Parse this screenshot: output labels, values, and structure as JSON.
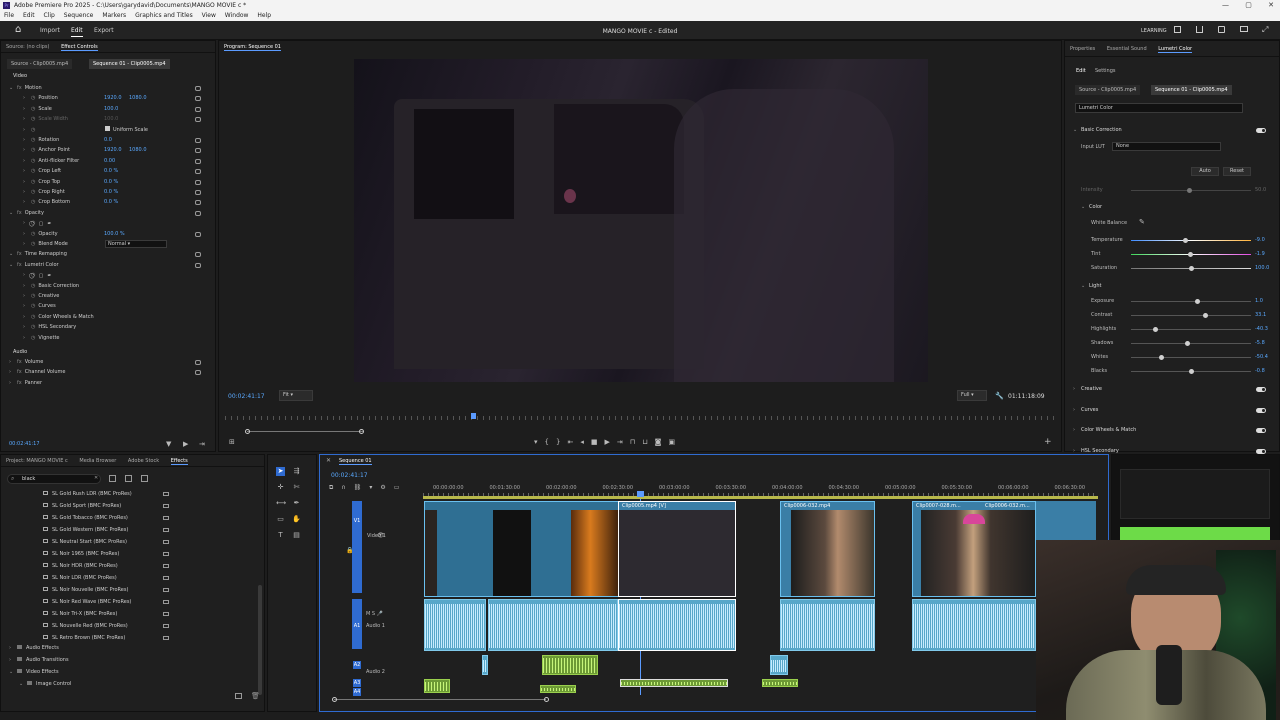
{
  "titlebar": {
    "title": "Adobe Premiere Pro 2025 - C:\\Users\\garydavid\\Documents\\MANGO MOVIE c *",
    "controls": [
      "—",
      "▢",
      "✕"
    ]
  },
  "menu": [
    "File",
    "Edit",
    "Clip",
    "Sequence",
    "Markers",
    "Graphics and Titles",
    "View",
    "Window",
    "Help"
  ],
  "appbar": {
    "home": "⌂",
    "workspaces": [
      "Import",
      "Edit",
      "Export"
    ],
    "active": "Edit",
    "doc_title": "MANGO MOVIE c - Edited",
    "learning": "LEARNING"
  },
  "effect_controls": {
    "tabs": [
      "Source: (no clips)",
      "Effect Controls"
    ],
    "source_tab": "Source - Clip0005.mp4",
    "seq_tab": "Sequence 01 - Clip0005.mp4",
    "video_label": "Video",
    "audio_label": "Audio",
    "rows": [
      {
        "name": "Motion",
        "fx": true,
        "indent": 0
      },
      {
        "name": "Position",
        "v1": "1920.0",
        "v2": "1080.0",
        "indent": 1
      },
      {
        "name": "Scale",
        "v1": "100.0",
        "indent": 1
      },
      {
        "name": "Scale Width",
        "v1": "100.0",
        "indent": 1,
        "dim": true
      },
      {
        "name": "",
        "check": "Uniform Scale",
        "indent": 1
      },
      {
        "name": "Rotation",
        "v1": "0.0",
        "indent": 1
      },
      {
        "name": "Anchor Point",
        "v1": "1920.0",
        "v2": "1080.0",
        "indent": 1
      },
      {
        "name": "Anti-flicker Filter",
        "v1": "0.00",
        "indent": 1
      },
      {
        "name": "Crop Left",
        "v1": "0.0 %",
        "indent": 1
      },
      {
        "name": "Crop Top",
        "v1": "0.0 %",
        "indent": 1
      },
      {
        "name": "Crop Right",
        "v1": "0.0 %",
        "indent": 1
      },
      {
        "name": "Crop Bottom",
        "v1": "0.0 %",
        "indent": 1
      },
      {
        "name": "Opacity",
        "fx": true,
        "indent": 0
      },
      {
        "name": "",
        "icons": true,
        "indent": 1
      },
      {
        "name": "Opacity",
        "v1": "100.0 %",
        "indent": 1
      },
      {
        "name": "Blend Mode",
        "sel": "Normal",
        "indent": 1
      },
      {
        "name": "Time Remapping",
        "fx": true,
        "indent": 0
      },
      {
        "name": "Lumetri Color",
        "fx": true,
        "indent": 0
      },
      {
        "name": "",
        "icons": true,
        "indent": 1
      },
      {
        "name": "Basic Correction",
        "indent": 1
      },
      {
        "name": "Creative",
        "indent": 1
      },
      {
        "name": "Curves",
        "indent": 1
      },
      {
        "name": "Color Wheels & Match",
        "indent": 1
      },
      {
        "name": "HSL Secondary",
        "indent": 1
      },
      {
        "name": "Vignette",
        "indent": 1
      }
    ],
    "audio_rows": [
      "Volume",
      "Channel Volume",
      "Panner"
    ],
    "timecode": "00:02:41:17"
  },
  "program": {
    "title": "Program: Sequence 01",
    "timecode": "00:02:41:17",
    "fit": "Fit",
    "quality": "Full",
    "duration": "01:11:18:09",
    "playhead_fraction": 0.4
  },
  "lumetri": {
    "tabs": [
      "Properties",
      "Essential Sound",
      "Lumetri Color"
    ],
    "subtabs": [
      "Edit",
      "Settings"
    ],
    "source": "Source - Clip0005.mp4",
    "seq": "Sequence 01 - Clip0005.mp4",
    "preset": "Lumetri Color",
    "basic_correction": "Basic Correction",
    "input_lut_label": "Input LUT",
    "input_lut": "None",
    "auto": "Auto",
    "reset": "Reset",
    "intensity": {
      "label": "Intensity",
      "value": "50.0"
    },
    "color_label": "Color",
    "white_balance": "White Balance",
    "sliders_color": [
      {
        "label": "Temperature",
        "value": "-9.0",
        "pos": 0.45
      },
      {
        "label": "Tint",
        "value": "-1.9",
        "pos": 0.49
      },
      {
        "label": "Saturation",
        "value": "100.0",
        "pos": 0.5
      }
    ],
    "light_label": "Light",
    "sliders_light": [
      {
        "label": "Exposure",
        "value": "1.0",
        "pos": 0.55
      },
      {
        "label": "Contrast",
        "value": "33.1",
        "pos": 0.62
      },
      {
        "label": "Highlights",
        "value": "-40.3",
        "pos": 0.2
      },
      {
        "label": "Shadows",
        "value": "-5.8",
        "pos": 0.47
      },
      {
        "label": "Whites",
        "value": "-50.4",
        "pos": 0.25
      },
      {
        "label": "Blacks",
        "value": "-0.8",
        "pos": 0.5
      }
    ],
    "sections": [
      "Creative",
      "Curves",
      "Color Wheels & Match",
      "HSL Secondary"
    ]
  },
  "project": {
    "tabs": [
      "Project: MANGO MOVIE c",
      "Media Browser",
      "Adobe Stock",
      "Effects"
    ],
    "search": "black",
    "items": [
      "SL Gold Rush LDR (BMC ProRes)",
      "SL Gold Sport (BMC ProRes)",
      "SL Gold Tobacco (BMC ProRes)",
      "SL Gold Western (BMC ProRes)",
      "SL Neutral Start (BMC ProRes)",
      "SL Noir 1965 (BMC ProRes)",
      "SL Noir HDR (BMC ProRes)",
      "SL Noir LDR (BMC ProRes)",
      "SL Noir Nouvelle (BMC ProRes)",
      "SL Noir Red Wave (BMC ProRes)",
      "SL Noir Tri-X (BMC ProRes)",
      "SL Nouvelle Red (BMC ProRes)",
      "SL Retro Brown (BMC ProRes)"
    ],
    "folders": [
      "Audio Effects",
      "Audio Transitions",
      "Video Effects",
      "Image Control"
    ]
  },
  "timeline": {
    "tab": "Sequence 01",
    "timecode": "00:02:41:17",
    "ruler": [
      "00:00:00:00",
      "00:01:30:00",
      "00:02:00:00",
      "00:02:30:00",
      "00:03:00:00",
      "00:03:30:00",
      "00:04:00:00",
      "00:04:30:00",
      "00:05:00:00",
      "00:05:30:00",
      "00:06:00:00",
      "00:06:30:00"
    ],
    "tracks": {
      "v1": "V1",
      "v1name": "Video 1",
      "a1": "A1",
      "a1name": "Audio 1",
      "a2": "A2",
      "a2name": "Audio 2",
      "a3": "A3",
      "a4": "A4"
    },
    "clips": [
      "Clip0005.mp4 [V]",
      "Clip0006-032.mp4",
      "Clip0007-028.m...",
      "Clip0006-032.m..."
    ]
  },
  "colors": {
    "accent": "#5b9bff",
    "clip": "#3a7ea6",
    "audio": "#57a7c9",
    "green": "#6d9a35"
  }
}
